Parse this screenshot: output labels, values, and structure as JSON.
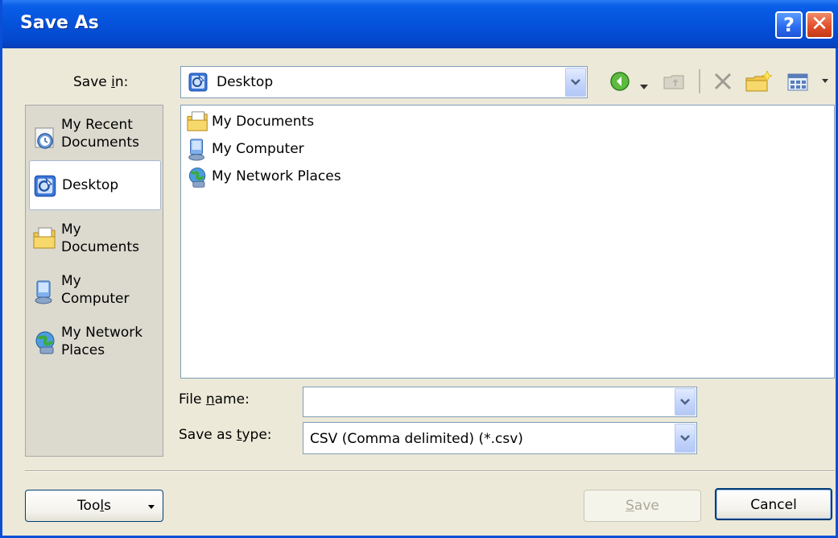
{
  "window": {
    "title": "Save As",
    "help_symbol": "?",
    "close_symbol": "✕"
  },
  "save_in": {
    "label_prefix": "Save ",
    "label_accel": "i",
    "label_suffix": "n:",
    "value": "Desktop",
    "icon": "desktop-icon"
  },
  "toolbar": {
    "icons": [
      "back-icon",
      "dropdown-arrow-icon",
      "up-folder-icon",
      "delete-icon",
      "new-folder-icon",
      "views-menu-icon"
    ]
  },
  "places_bar": {
    "items": [
      {
        "label_line1": "My Recent",
        "label_line2": "Documents",
        "icon": "recent-documents-icon"
      },
      {
        "label_line1": "Desktop",
        "label_line2": "",
        "icon": "desktop-icon",
        "selected": true
      },
      {
        "label_line1": "My",
        "label_line2": "Documents",
        "icon": "my-documents-icon"
      },
      {
        "label_line1": "My",
        "label_line2": "Computer",
        "icon": "my-computer-icon"
      },
      {
        "label_line1": "My Network",
        "label_line2": "Places",
        "icon": "network-places-icon"
      }
    ]
  },
  "file_list": {
    "items": [
      {
        "label": "My Documents",
        "icon": "my-documents-icon"
      },
      {
        "label": "My Computer",
        "icon": "my-computer-icon"
      },
      {
        "label": "My Network Places",
        "icon": "network-places-icon"
      }
    ]
  },
  "file_name": {
    "label_prefix": "File ",
    "label_accel": "n",
    "label_suffix": "ame:",
    "value": ""
  },
  "save_as_type": {
    "label_prefix": "Save as ",
    "label_accel": "t",
    "label_suffix": "ype:",
    "value": "CSV (Comma delimited) (*.csv)"
  },
  "buttons": {
    "tools_prefix": "Too",
    "tools_accel": "l",
    "tools_suffix": "s",
    "save_accel": "S",
    "save_suffix": "ave",
    "cancel": "Cancel"
  },
  "colors": {
    "titlebar": "#0552DA",
    "dialog_bg": "#ECE9D8",
    "places_bg": "#DCDACF",
    "close_button": "#E2512A",
    "help_button": "#2A6AF0"
  }
}
